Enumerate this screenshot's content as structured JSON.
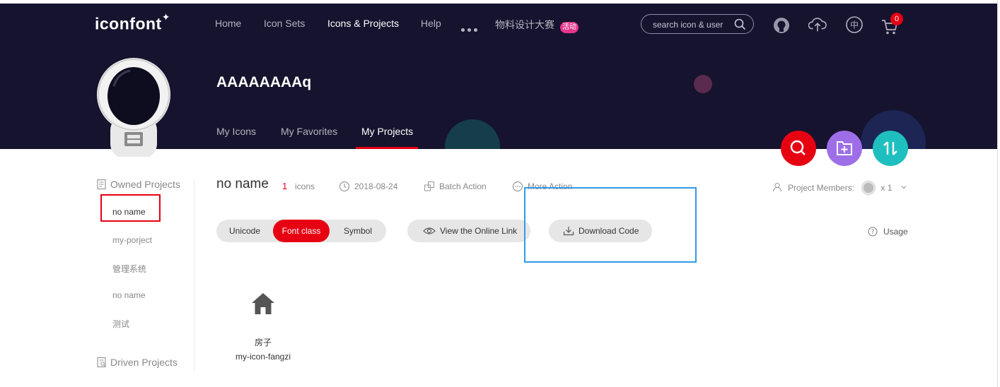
{
  "header": {
    "logo": "iconfont",
    "nav": [
      "Home",
      "Icon Sets",
      "Icons & Projects",
      "Help"
    ],
    "nav_active": "Icons & Projects",
    "contest_label": "物料设计大赛",
    "contest_badge": "活动",
    "search_placeholder": "search icon & user",
    "cart_count": "0",
    "icons": [
      "github-icon",
      "upload-cloud-icon",
      "language-zh-icon",
      "cart-icon"
    ]
  },
  "profile": {
    "username": "AAAAAAAAq",
    "tabs": [
      "My Icons",
      "My Favorites",
      "My Projects"
    ],
    "active_tab": "My Projects"
  },
  "fabs": [
    {
      "name": "search",
      "color": "#e60012"
    },
    {
      "name": "new-folder",
      "color": "#9e6ee8"
    },
    {
      "name": "sort",
      "color": "#1fbfbf"
    }
  ],
  "sidebar": {
    "owned_label": "Owned Projects",
    "owned_items": [
      "no name",
      "my-porject",
      "管理系统",
      "no name",
      "测试"
    ],
    "active_item": 0,
    "driven_label": "Driven Projects"
  },
  "project": {
    "title": "no name",
    "count": "1",
    "count_unit": "icons",
    "date": "2018-08-24",
    "batch_action": "Batch Action",
    "more_action": "More Action",
    "members_label": "Project Members:",
    "members_count": "x 1",
    "formats": [
      "Unicode",
      "Font class",
      "Symbol"
    ],
    "active_format": "Font class",
    "view_online_link": "View the Online Link",
    "download_code": "Download Code",
    "usage": "Usage",
    "icons": [
      {
        "name": "房子",
        "class": "my-icon-fangzi",
        "glyph": "house-icon"
      }
    ]
  },
  "colors": {
    "header_bg": "#16132e",
    "accent": "#e60012",
    "highlight_box": "#3399e6"
  }
}
